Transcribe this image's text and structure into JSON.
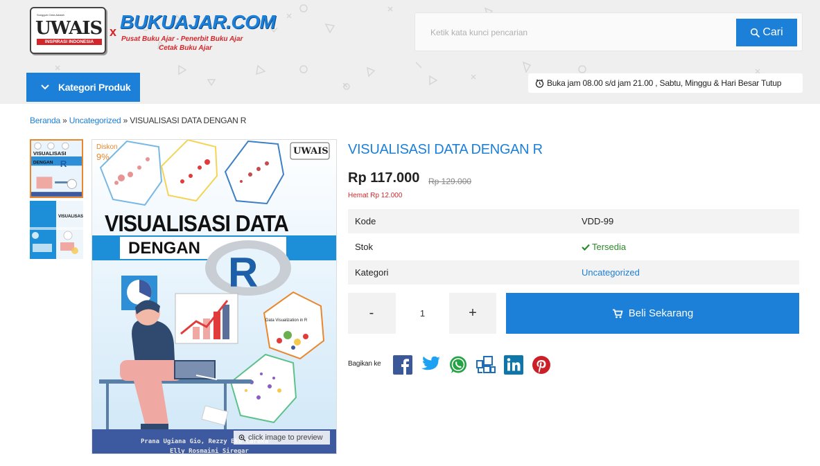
{
  "header": {
    "logo_uwais": {
      "tagline_small": "Sungguh Cinta Adalah",
      "word": "UWAIS",
      "subtitle": "INSPIRASI INDONESIA"
    },
    "logo_separator": "x",
    "logo_bukuajar": {
      "word": "BUKUAJAR.COM",
      "sub1": "Pusat Buku Ajar - Penerbit Buku Ajar",
      "sub2": "Cetak Buku Ajar"
    },
    "search": {
      "placeholder": "Ketik kata kunci pencarian",
      "button_label": "Cari",
      "icon": "search-icon"
    },
    "category_button": "Kategori Produk",
    "hours_text": "Buka jam 08.00 s/d jam 21.00 , Sabtu, Minggu & Hari Besar Tutup"
  },
  "breadcrumb": {
    "home": "Beranda",
    "sep1": "»",
    "category": "Uncategorized",
    "sep2": "»",
    "current": "VISUALISASI DATA DENGAN R"
  },
  "gallery": {
    "badge_label": "Diskon",
    "badge_value": "9%",
    "preview_hint": "click image to preview",
    "cover_title_line1": "VISUALISASI DATA",
    "cover_title_line2": "DENGAN",
    "cover_letter": "R",
    "cover_publisher": "UWAIS",
    "cover_authors_line1": "Prana Ugiana Gio, Rezzy Eko Caraka",
    "cover_authors_line2": "Elly Rosmaini Siregar",
    "cover_inset_title": "Data Visualization in R"
  },
  "product": {
    "title": "VISUALISASI DATA DENGAN R",
    "price": "Rp 117.000",
    "old_price": "Rp 129.000",
    "savings": "Hemat Rp 12.000",
    "details": [
      {
        "key": "Kode",
        "value": "VDD-99"
      },
      {
        "key": "Stok",
        "value": "Tersedia"
      },
      {
        "key": "Kategori",
        "value": "Uncategorized"
      }
    ],
    "quantity": {
      "minus": "-",
      "value": "1",
      "plus": "+"
    },
    "buy_button": "Beli Sekarang",
    "share_label": "Bagikan ke"
  },
  "colors": {
    "accent": "#1c7fd8",
    "discount": "#e8872b",
    "red": "#d3262a",
    "stock_green": "#2a8a2a"
  }
}
